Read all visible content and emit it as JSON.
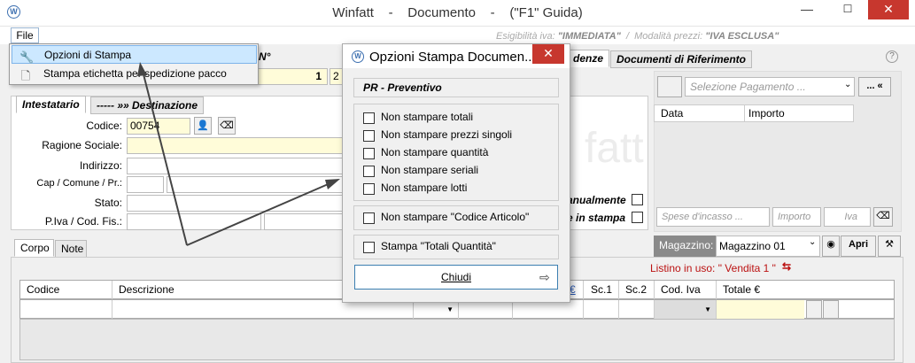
{
  "window": {
    "title": "Winfatt    -    Documento    -    (\"F1\" Guida)",
    "minimize": "—",
    "maximize": "☐",
    "close": "✕"
  },
  "menubar": {
    "file": "File"
  },
  "info": {
    "esig_label": "Esigibilità iva: ",
    "esig_value": "\"IMMEDIATA\"",
    "sep": "  /  ",
    "mod_label": "Modalità prezzi: ",
    "mod_value": "\"IVA ESCLUSA\""
  },
  "file_menu": {
    "items": [
      {
        "label": "Opzioni di Stampa",
        "icon": "tools-icon"
      },
      {
        "label": "Stampa etichetta per spedizione pacco",
        "icon": "label-icon"
      }
    ]
  },
  "header": {
    "numero_label": "N°",
    "numero_value": "1",
    "second_value": "2"
  },
  "right_tabs": [
    {
      "label": "denze"
    },
    {
      "label": "Documenti di Riferimento"
    }
  ],
  "help": "?",
  "anagrafica": {
    "tabs": [
      "Intestatario",
      "----- »» Destinazione"
    ],
    "fields": [
      {
        "label": "Codice:",
        "value": "00754"
      },
      {
        "label": "Ragione Sociale:",
        "value": ""
      },
      {
        "label": "Indirizzo:",
        "value": ""
      },
      {
        "label": "Cap / Comune / Pr.:",
        "value": ""
      },
      {
        "label": "Stato:",
        "value": ""
      },
      {
        "label": "P.Iva / Cod. Fis.:",
        "value": ""
      }
    ]
  },
  "pagamento": {
    "placeholder": "Selezione Pagamento ...",
    "btn": "... «",
    "cols": [
      "Data",
      "Importo"
    ],
    "spese_placeholder": "Spese d'incasso ...",
    "importo_placeholder": "Importo",
    "iva_placeholder": "Iva"
  },
  "flags": {
    "manual": "anualmente",
    "instampa": "e in stampa"
  },
  "watermark": "fatt",
  "body_tabs": [
    "Corpo",
    "Note"
  ],
  "magazzino": {
    "label": "Magazzino:",
    "value": "Magazzino 01",
    "apri": "Apri"
  },
  "listino": "Listino in uso: \" Vendita 1 \"",
  "grid": {
    "cols": [
      "Codice",
      "Descrizione",
      "€",
      "Sc.1",
      "Sc.2",
      "Cod. Iva",
      "Totale €"
    ]
  },
  "dialog": {
    "title": "Opzioni Stampa Documen...",
    "section": "PR - Preventivo",
    "group1": [
      "Non stampare totali",
      "Non stampare prezzi singoli",
      "Non stampare quantità",
      "Non stampare seriali",
      "Non stampare lotti"
    ],
    "group2": [
      "Non stampare \"Codice Articolo\""
    ],
    "group3": [
      "Stampa \"Totali Quantità\""
    ],
    "close_label": "Chiudi"
  }
}
